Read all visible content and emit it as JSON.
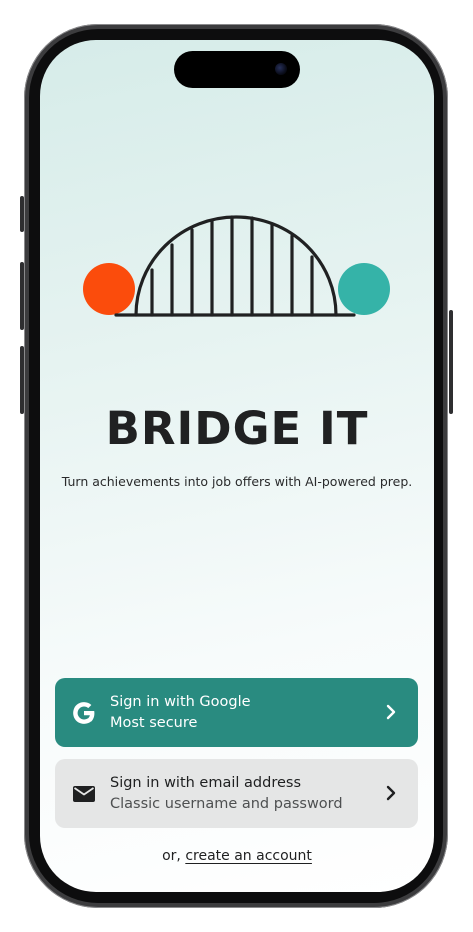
{
  "app": {
    "title": "BRIDGE IT",
    "tagline": "Turn achievements into job offers with AI-powered prep."
  },
  "logo": {
    "icon": "bridge-logo",
    "left_circle_color": "#fb4c0c",
    "right_circle_color": "#35b3a8",
    "bridge_color": "#202122"
  },
  "auth": {
    "google": {
      "label": "Sign in with Google",
      "sublabel": "Most secure",
      "icon": "google-icon",
      "background": "#298b80"
    },
    "email": {
      "label": "Sign in with email address",
      "sublabel": "Classic username and password",
      "icon": "mail-icon",
      "background": "#e5e6e6"
    }
  },
  "footer": {
    "prefix": "or, ",
    "create_account_label": "create an account"
  }
}
